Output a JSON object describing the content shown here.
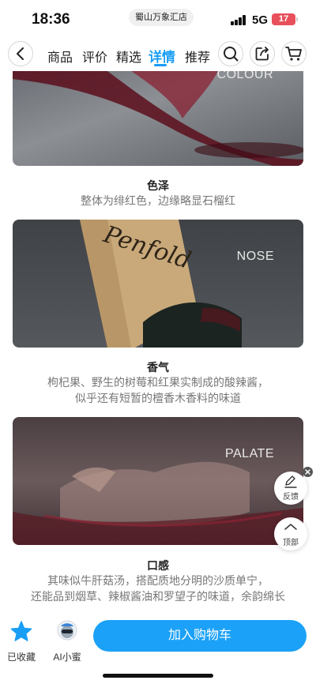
{
  "status_bar": {
    "time": "18:36",
    "location": "蜀山万象汇店",
    "network": "5G",
    "battery": "17"
  },
  "nav": {
    "tabs": [
      {
        "label": "商品",
        "active": false
      },
      {
        "label": "评价",
        "active": false
      },
      {
        "label": "精选",
        "active": false
      },
      {
        "label": "详情",
        "active": true
      },
      {
        "label": "推荐",
        "active": false
      }
    ],
    "active_color": "#1a9ef5"
  },
  "sections": [
    {
      "label": "COLOUR",
      "title": "色泽",
      "text": [
        "整体为绯红色，边缘略显石榴红"
      ]
    },
    {
      "label": "NOSE",
      "title": "香气",
      "text": [
        "枸杞果、野生的树莓和红果实制成的酸辣酱，",
        "似乎还有短暂的檀香木香料的味道"
      ]
    },
    {
      "label": "PALATE",
      "title": "口感",
      "text": [
        "其味似牛肝菇汤，搭配质地分明的沙质单宁，",
        "还能品到烟草、辣椒酱油和罗望子的味道，余韵绵长"
      ]
    }
  ],
  "floating": {
    "feedback": "反馈",
    "top": "顶部"
  },
  "bottom_bar": {
    "favorite": "已收藏",
    "assistant": "AI小蜜",
    "add_to_cart": "加入购物车",
    "accent": "#1ba1f7"
  }
}
